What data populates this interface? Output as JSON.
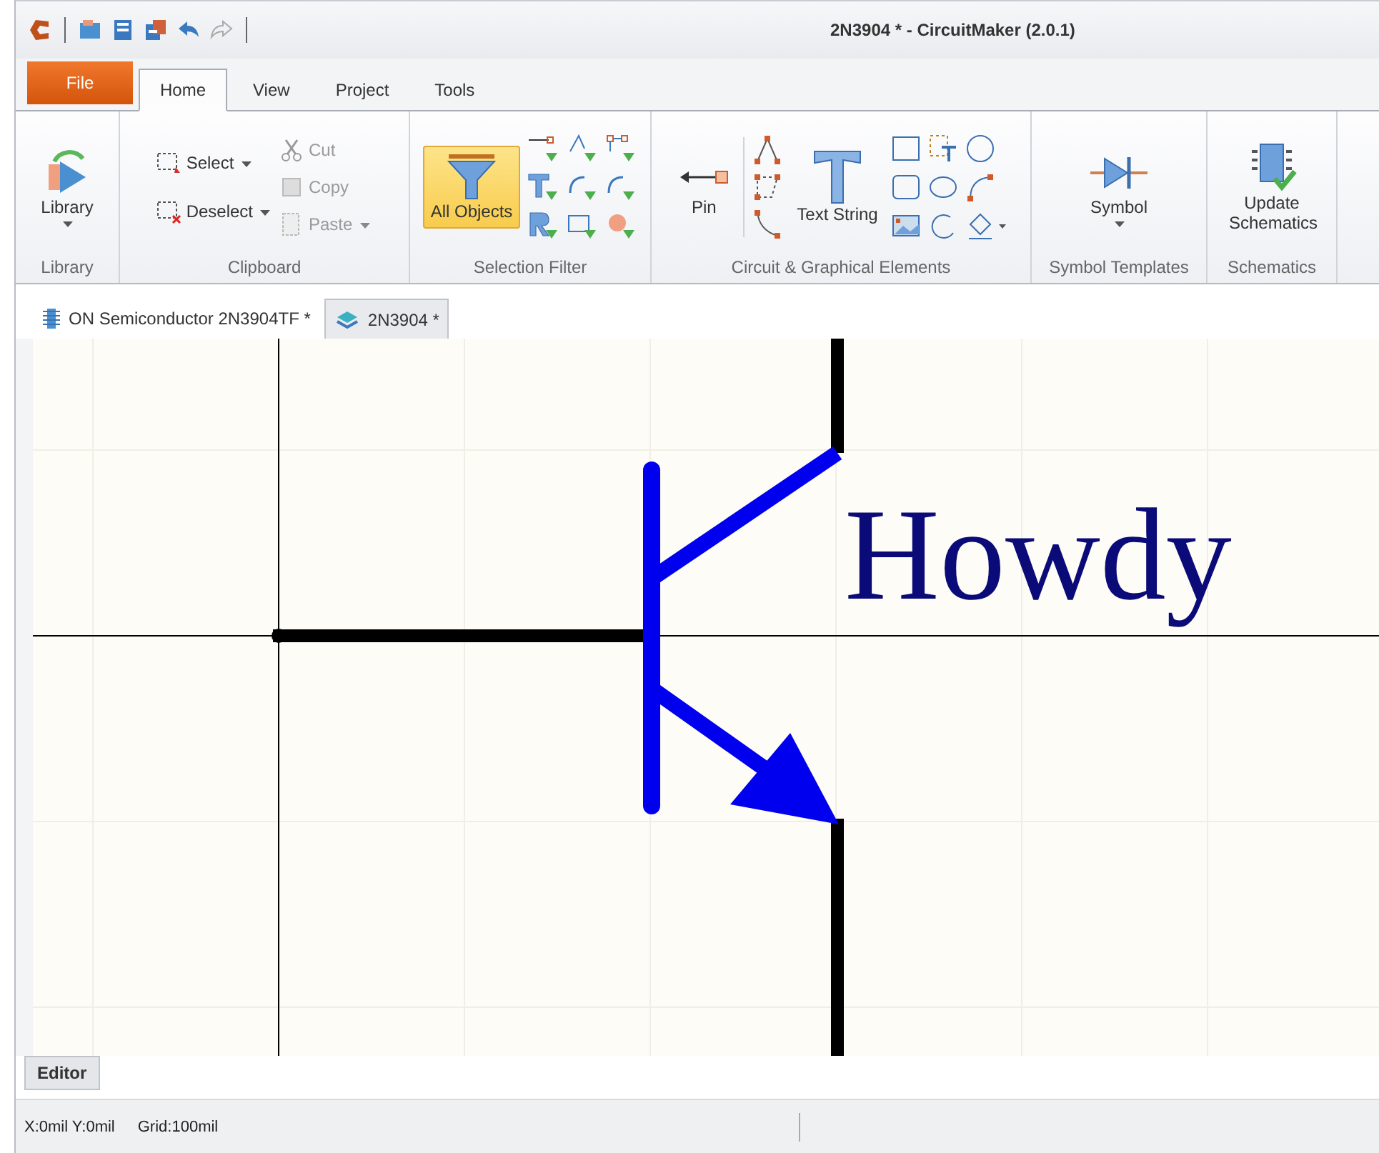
{
  "window": {
    "title": "2N3904 * - CircuitMaker (2.0.1)"
  },
  "menu_tabs": [
    {
      "label": "File",
      "kind": "file",
      "selected": false
    },
    {
      "label": "Home",
      "kind": "tab",
      "selected": true
    },
    {
      "label": "View",
      "kind": "tab",
      "selected": false
    },
    {
      "label": "Project",
      "kind": "tab",
      "selected": false
    },
    {
      "label": "Tools",
      "kind": "tab",
      "selected": false
    }
  ],
  "ribbon": {
    "library": {
      "label": "Library",
      "button": "Library"
    },
    "clipboard": {
      "label": "Clipboard",
      "select": {
        "label": "Select",
        "disabled": false
      },
      "deselect": {
        "label": "Deselect",
        "disabled": false
      },
      "cut": {
        "label": "Cut",
        "disabled": true
      },
      "copy": {
        "label": "Copy",
        "disabled": true
      },
      "paste": {
        "label": "Paste",
        "disabled": true
      }
    },
    "selection_filter": {
      "label": "Selection Filter",
      "all_objects": {
        "label": "All Objects",
        "selected": true
      }
    },
    "elements": {
      "label": "Circuit & Graphical Elements",
      "pin": "Pin",
      "text_string": "Text String"
    },
    "symbol_templates": {
      "label": "Symbol Templates",
      "symbol": "Symbol"
    },
    "schematics": {
      "label": "Schematics",
      "update": "Update Schematics"
    }
  },
  "document_tabs": [
    {
      "label": "ON Semiconductor 2N3904TF *",
      "selected": false
    },
    {
      "label": "2N3904 *",
      "selected": true
    }
  ],
  "canvas": {
    "text": "Howdy"
  },
  "bottom_tabs": [
    {
      "label": "Editor",
      "selected": true
    }
  ],
  "status_bar": {
    "coordinates": "X:0mil Y:0mil",
    "grid": "Grid:100mil"
  }
}
